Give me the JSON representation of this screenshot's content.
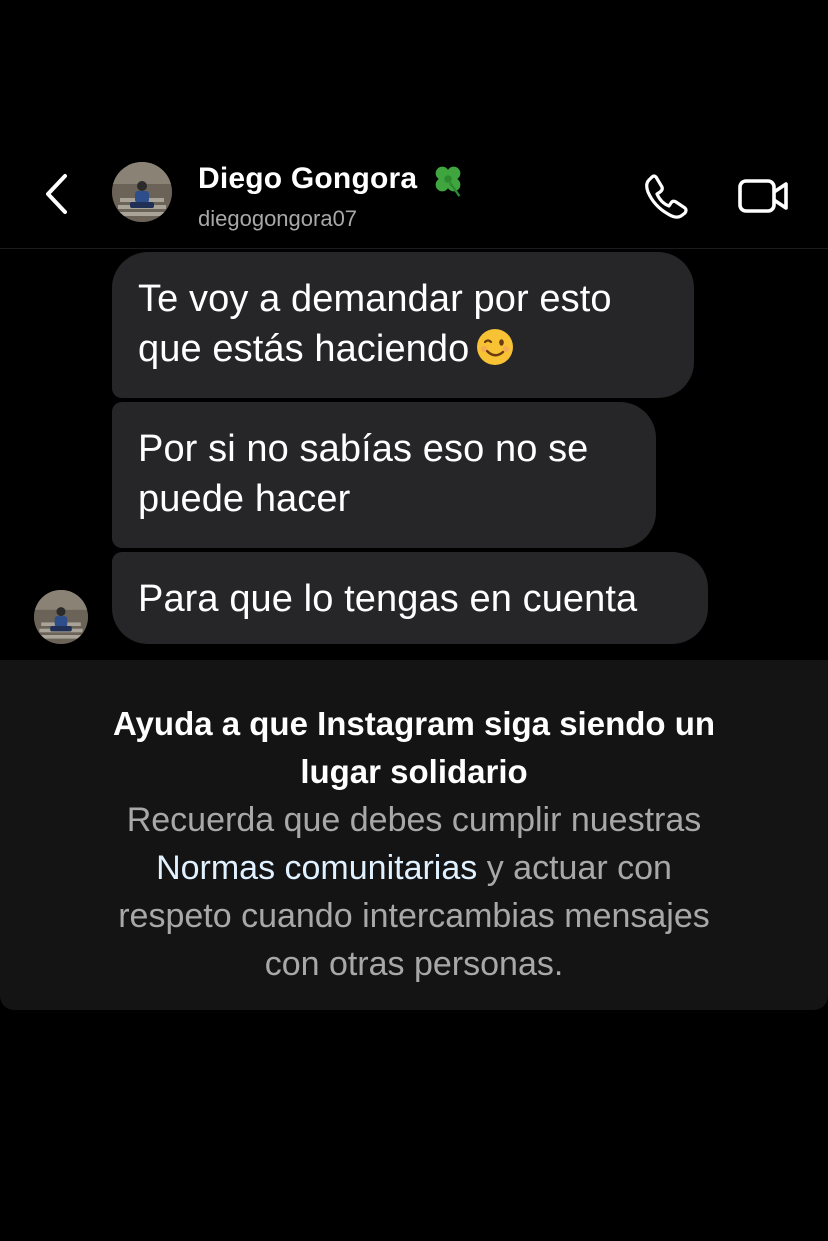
{
  "header": {
    "name": "Diego Gongora",
    "name_emoji": "four-leaf-clover-icon",
    "username": "diegogongora07"
  },
  "messages": [
    {
      "line1": "Te voy a demandar por esto",
      "line2": "que estás haciendo",
      "emoji": "winking-face-icon"
    },
    {
      "line1": "Por si no sabías eso no se",
      "line2": "puede hacer"
    },
    {
      "line1": "Para que lo tengas en cuenta"
    }
  ],
  "notice": {
    "title_line1": "Ayuda a que Instagram siga siendo un",
    "title_line2": "lugar solidario",
    "body_before_link": "Recuerda que debes cumplir nuestras",
    "link_text": "Normas comunitarias",
    "body_after_link": " y actuar con",
    "body_line3": "respeto cuando intercambias mensajes",
    "body_line4": "con otras personas."
  },
  "colors": {
    "background": "#000000",
    "bubble": "#262628",
    "secondary_text": "#a8a8a8",
    "link": "#e0f1ff",
    "notice_bg": "#141414",
    "clover": "#3fa63f"
  }
}
